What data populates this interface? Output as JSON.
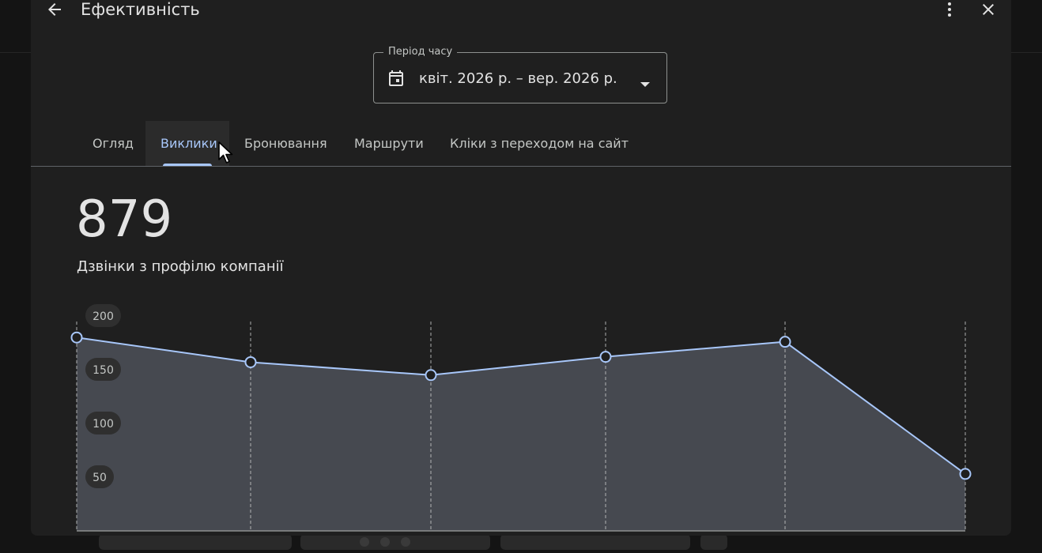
{
  "header": {
    "title": "Ефективність",
    "back_icon": "arrow-back-icon",
    "more_icon": "more-vert-icon",
    "close_icon": "close-icon"
  },
  "period": {
    "legend": "Період часу",
    "value": "квіт. 2026 р. – вер. 2026 р.",
    "icon": "calendar-icon",
    "arrow_icon": "dropdown-arrow-icon"
  },
  "tabs": [
    {
      "label": "Огляд",
      "active": false
    },
    {
      "label": "Виклики",
      "active": true
    },
    {
      "label": "Бронювання",
      "active": false
    },
    {
      "label": "Маршрути",
      "active": false
    },
    {
      "label": "Кліки з переходом на сайт",
      "active": false
    }
  ],
  "metric": {
    "value": "879",
    "label": "Дзвінки з профілю компанії"
  },
  "colors": {
    "accent": "#a8c7fa",
    "area_fill": "#464950",
    "background": "#1f1f1f",
    "text": "#e3e3e3"
  },
  "chart_data": {
    "type": "area",
    "x": [
      1,
      2,
      3,
      4,
      5,
      6
    ],
    "values": [
      180,
      157,
      145,
      162,
      176,
      53
    ],
    "y_ticks": [
      50,
      100,
      150,
      200
    ],
    "ylim": [
      0,
      200
    ],
    "grid": "vertical-dashed",
    "title": "",
    "xlabel": "",
    "ylabel": ""
  }
}
